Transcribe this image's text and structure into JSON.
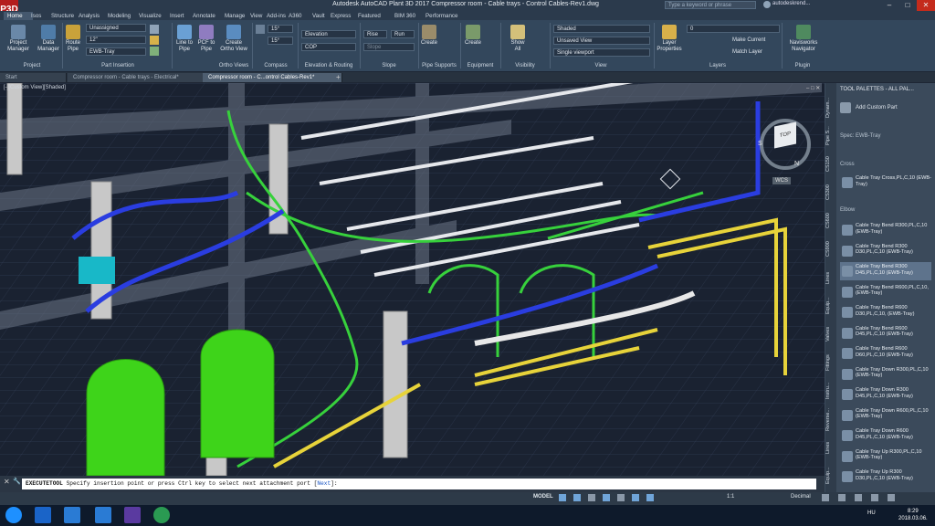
{
  "app": {
    "logo": "P3D",
    "title": "Autodesk AutoCAD Plant 3D 2017    Compressor room - Cable trays - Control Cables-Rev1.dwg",
    "search_placeholder": "Type a keyword or phrase",
    "user": "autodeskrend...",
    "accent": "#b41d1d"
  },
  "ribbon_tabs": [
    "Home",
    "Isos",
    "Structure",
    "Analysis",
    "Modeling",
    "Visualize",
    "Insert",
    "Annotate",
    "Manage",
    "View",
    "Add-ins",
    "A360",
    "Vault",
    "Express Tools",
    "Featured Apps",
    "BIM 360",
    "Performance"
  ],
  "ribbon": {
    "project": {
      "project_manager": "Project Manager",
      "data_manager": "Data Manager",
      "panel": "Project"
    },
    "part_insertion": {
      "route_pipe": "Route Pipe",
      "dd1": "Unassigned",
      "dd2": "12\"",
      "dd3": "EWB-Tray",
      "panel": "Part Insertion"
    },
    "ortho": {
      "line_to_pipe": "Line to Pipe",
      "pcf_to_pipe": "PCF to Pipe",
      "create_ortho": "Create Ortho View",
      "panel": "Ortho Views"
    },
    "compass": {
      "a1": "15°",
      "a2": "15°",
      "panel": "Compass"
    },
    "elevation": {
      "field": "Elevation",
      "cop": "COP",
      "panel": "Elevation & Routing"
    },
    "slope": {
      "rise": "Rise",
      "run": "Run",
      "slope": "Slope",
      "panel": "Slope"
    },
    "pipe_supports": {
      "create": "Create",
      "panel": "Pipe Supports"
    },
    "equipment": {
      "create": "Create",
      "panel": "Equipment"
    },
    "visibility": {
      "show_all": "Show All",
      "panel": "Visibility"
    },
    "view": {
      "visual_style": "Shaded",
      "named_view": "Unsaved View",
      "viewport": "Single viewport",
      "panel": "View"
    },
    "layers": {
      "layer_props": "Layer Properties",
      "layer_value": "0",
      "make_current": "Make Current",
      "match_layer": "Match Layer",
      "panel": "Layers"
    },
    "plugin": {
      "navisworks": "Navisworks Navigator",
      "panel": "Plugin"
    }
  },
  "doc_tabs": [
    "Start",
    "Compressor room - Cable trays - Electrical*",
    "Compressor room - C...ontrol Cables-Rev1*"
  ],
  "viewport_label": "[-][Custom View][Shaded]",
  "viewcube": {
    "face": "TOP",
    "wcs": "WCS",
    "n": "N",
    "s": "S"
  },
  "palette": {
    "title": "TOOL PALETTES - ALL PAL...",
    "add_custom": "Add Custom Part",
    "spec": "Spec: EWB-Tray",
    "side_tabs": [
      "Dynam...",
      "Pipe S...",
      "CS150",
      "CS300",
      "CS600",
      "CS900",
      "Lines",
      "Equip...",
      "Valves",
      "Fittings",
      "Instru...",
      "Reverse...",
      "Lines",
      "Equip..."
    ],
    "groups": {
      "cross": "Cross",
      "elbow": "Elbow"
    },
    "cross_items": [
      "Cable Tray Cross,PL,C,10 (EWB-Tray)"
    ],
    "elbow_items": [
      "Cable Tray Bend R300,PL,C,10 (EWB-Tray)",
      "Cable Tray Bend R300 D30,PL,C,10 (EWB-Tray)",
      "Cable Tray Bend R300 D45,PL,C,10 (EWB-Tray)",
      "Cable Tray Bend R600,PL,C,10, (EWB-Tray)",
      "Cable Tray Bend R600 D30,PL,C,10, (EWB-Tray)",
      "Cable Tray Bend R600 D45,PL,C,10 (EWB-Tray)",
      "Cable Tray Bend R600 D60,PL,C,10 (EWB-Tray)",
      "Cable Tray Down R300,PL,C,10 (EWB-Tray)",
      "Cable Tray Down R300 D45,PL,C,10 (EWB-Tray)",
      "Cable Tray Down R600,PL,C,10 (EWB-Tray)",
      "Cable Tray Down R600 D45,PL,C,10 (EWB-Tray)",
      "Cable Tray Up R300,PL,C,10 (EWB-Tray)",
      "Cable Tray Up R300 D30,PL,C,10 (EWB-Tray)"
    ],
    "selected_index": 2
  },
  "command": {
    "name": "EXECUTETOOL",
    "text": "Specify insertion point or press Ctrl key to select next attachment port [",
    "option": "Next",
    "tail": "]:"
  },
  "status": {
    "model": "MODEL",
    "scale": "1:1",
    "units": "Decimal"
  },
  "clock": {
    "time": "8:29",
    "date": "2018.03.06.",
    "lang": "HU"
  }
}
